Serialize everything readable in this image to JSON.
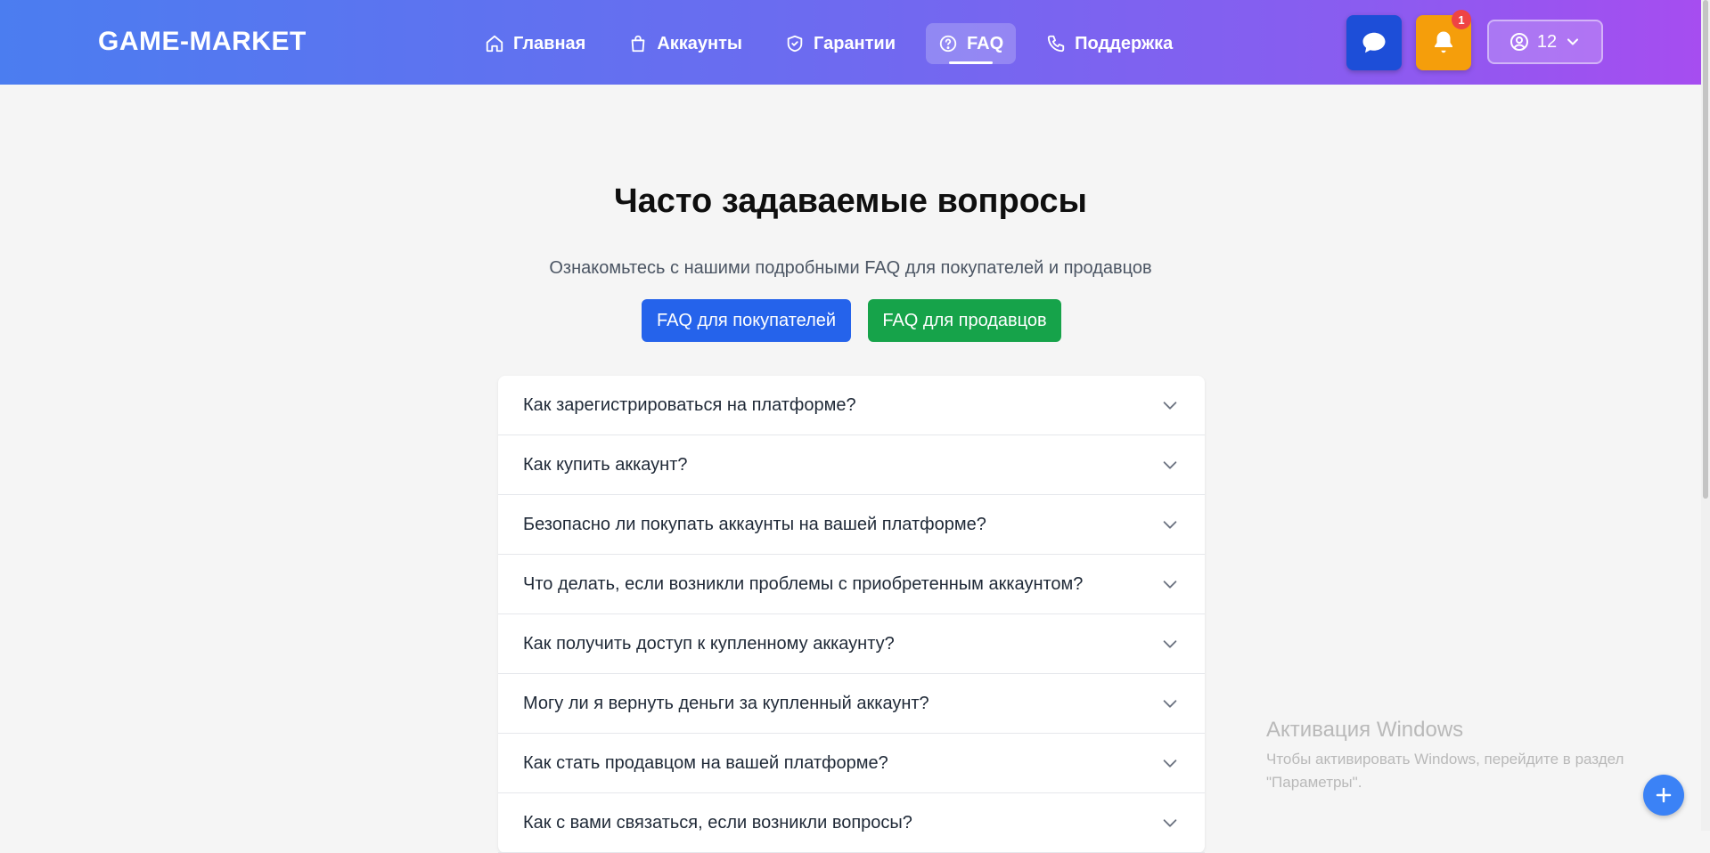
{
  "header": {
    "logo": "GAME-MARKET",
    "nav": [
      {
        "label": "Главная",
        "icon": "home-icon"
      },
      {
        "label": "Аккаунты",
        "icon": "shopping-bag-icon"
      },
      {
        "label": "Гарантии",
        "icon": "shield-icon"
      },
      {
        "label": "FAQ",
        "icon": "help-circle-icon",
        "active": true
      },
      {
        "label": "Поддержка",
        "icon": "phone-icon"
      }
    ],
    "notification_count": "1",
    "user_label": "12"
  },
  "main": {
    "title": "Часто задаваемые вопросы",
    "subtitle": "Ознакомьтесь с нашими подробными FAQ для покупателей и продавцов",
    "buyers_button": "FAQ для покупателей",
    "sellers_button": "FAQ для продавцов",
    "faq": [
      "Как зарегистрироваться на платформе?",
      "Как купить аккаунт?",
      "Безопасно ли покупать аккаунты на вашей платформе?",
      "Что делать, если возникли проблемы с приобретенным аккаунтом?",
      "Как получить доступ к купленному аккаунту?",
      "Могу ли я вернуть деньги за купленный аккаунт?",
      "Как стать продавцом на вашей платформе?",
      "Как с вами связаться, если возникли вопросы?"
    ]
  },
  "watermark": {
    "title": "Активация Windows",
    "text": "Чтобы активировать Windows, перейдите в раздел \"Параметры\"."
  },
  "colors": {
    "primary": "#2563eb",
    "success": "#16a34a",
    "warning": "#f59e0b",
    "chat": "#1d4ed8"
  }
}
